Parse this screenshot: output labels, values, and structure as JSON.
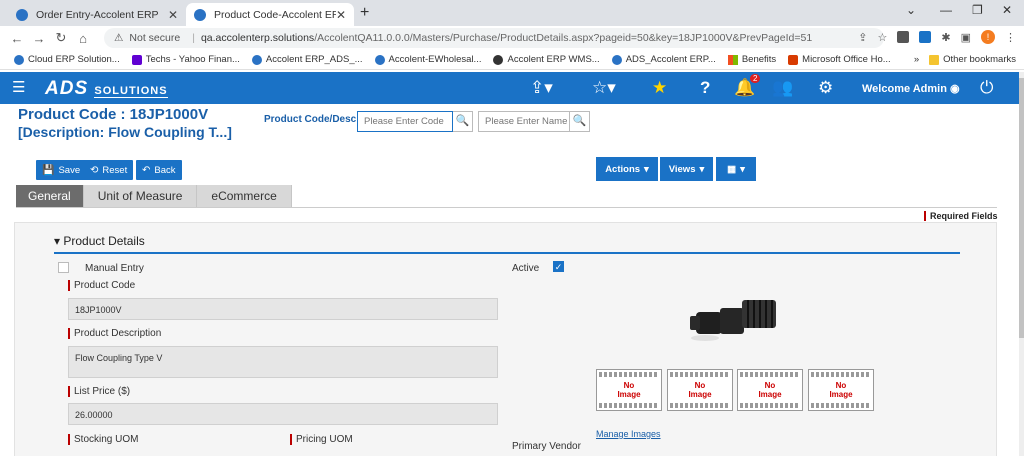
{
  "browser": {
    "tabs": [
      {
        "title": "Order Entry-Accolent ERP"
      },
      {
        "title": "Product Code-Accolent ERP"
      }
    ],
    "new_tab": "+",
    "not_secure": "Not secure",
    "url_host": "qa.accolenterp.solutions",
    "url_path": "/AccolentQA11.0.0.0/Masters/Purchase/ProductDetails.aspx?pageid=50&key=18JP1000V&PrevPageId=51",
    "profile_initial": "!",
    "bookmarks": [
      {
        "label": "Cloud ERP Solution...",
        "icon": "cloud-icon"
      },
      {
        "label": "Techs - Yahoo Finan...",
        "icon": "yahoo-icon"
      },
      {
        "label": "Accolent ERP_ADS_...",
        "icon": "accolent-icon"
      },
      {
        "label": "Accolent-EWholesal...",
        "icon": "accolent-icon"
      },
      {
        "label": "Accolent ERP WMS...",
        "icon": "globe-icon"
      },
      {
        "label": "ADS_Accolent ERP...",
        "icon": "accolent-icon"
      },
      {
        "label": "Benefits",
        "icon": "microsoft-icon"
      },
      {
        "label": "Microsoft Office Ho...",
        "icon": "office-icon"
      }
    ],
    "bookmarks_more": "»",
    "other_bookmarks": "Other bookmarks"
  },
  "app": {
    "logo": "ADS",
    "logo_sub": "SOLUTIONS",
    "notification_count": "2",
    "welcome": "Welcome Admin"
  },
  "page": {
    "title_line1": "Product Code  : 18JP1000V",
    "title_line2": "[Description: Flow Coupling T...]",
    "search_label": "Product Code/Desc",
    "code_placeholder": "Please Enter Code",
    "name_placeholder": "Please Enter Name"
  },
  "toolbar": {
    "save": "Save",
    "reset": "Reset",
    "back": "Back",
    "actions": "Actions",
    "views": "Views"
  },
  "tabs": [
    "General",
    "Unit of Measure",
    "eCommerce"
  ],
  "required_fields": "Required Fields",
  "section": {
    "title": "Product Details",
    "manual_entry": "Manual Entry",
    "active": "Active",
    "product_code_label": "Product Code",
    "product_code_value": "18JP1000V",
    "description_label": "Product Description",
    "description_value": "Flow Coupling Type V",
    "list_price_label": "List Price ($)",
    "list_price_value": "26.00000",
    "stocking_uom_label": "Stocking UOM",
    "pricing_uom_label": "Pricing UOM",
    "primary_vendor_label": "Primary Vendor"
  },
  "images": {
    "no_image": [
      "No",
      "Image"
    ],
    "manage_link": "Manage Images"
  },
  "colors": {
    "brand_blue": "#1a72c6",
    "required_red": "#b00000"
  }
}
